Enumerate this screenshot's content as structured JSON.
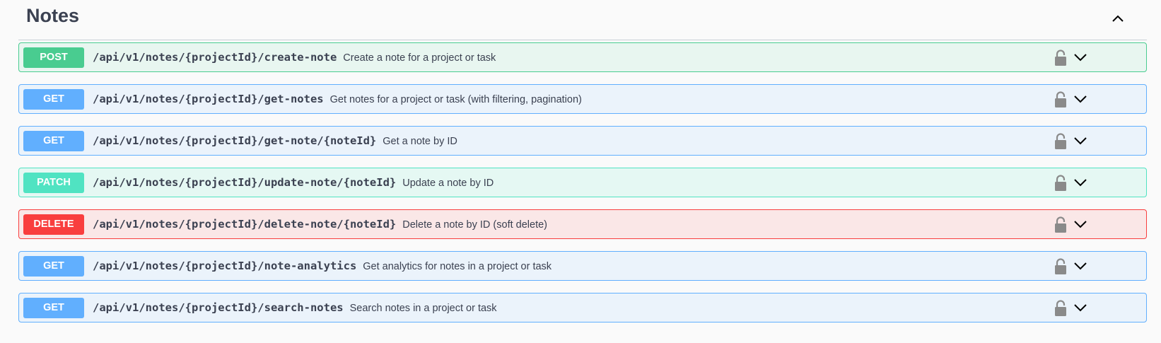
{
  "section": {
    "title": "Notes",
    "collapse_icon": "chevron-up-icon"
  },
  "operations": [
    {
      "method": "POST",
      "path": "/api/v1/notes/{projectId}/create-note",
      "summary": "Create a note for a project or task"
    },
    {
      "method": "GET",
      "path": "/api/v1/notes/{projectId}/get-notes",
      "summary": "Get notes for a project or task (with filtering, pagination)"
    },
    {
      "method": "GET",
      "path": "/api/v1/notes/{projectId}/get-note/{noteId}",
      "summary": "Get a note by ID"
    },
    {
      "method": "PATCH",
      "path": "/api/v1/notes/{projectId}/update-note/{noteId}",
      "summary": "Update a note by ID"
    },
    {
      "method": "DELETE",
      "path": "/api/v1/notes/{projectId}/delete-note/{noteId}",
      "summary": "Delete a note by ID (soft delete)"
    },
    {
      "method": "GET",
      "path": "/api/v1/notes/{projectId}/note-analytics",
      "summary": "Get analytics for notes in a project or task"
    },
    {
      "method": "GET",
      "path": "/api/v1/notes/{projectId}/search-notes",
      "summary": "Search notes in a project or task"
    }
  ],
  "icons": {
    "lock": "lock-icon",
    "expand": "chevron-down-icon"
  },
  "colors": {
    "post": "#49cc90",
    "get": "#61affe",
    "patch": "#50e3c2",
    "delete": "#f93e3e",
    "text": "#3b4151"
  }
}
